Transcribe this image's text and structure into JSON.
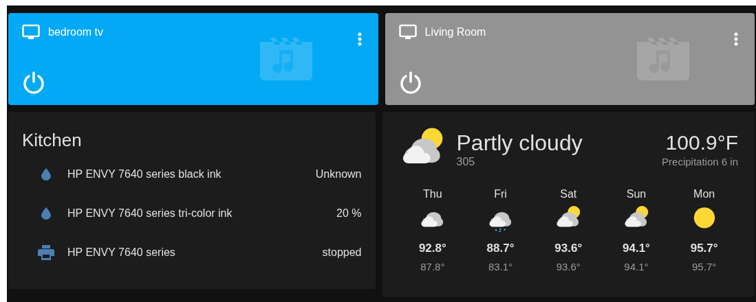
{
  "media_players": [
    {
      "name": "bedroom tv",
      "on": true
    },
    {
      "name": "Living Room",
      "on": false
    }
  ],
  "entities_card": {
    "title": "Kitchen",
    "rows": [
      {
        "kind": "ink",
        "name": "HP ENVY 7640 series black ink",
        "state": "Unknown"
      },
      {
        "kind": "ink",
        "name": "HP ENVY 7640 series tri-color ink",
        "state": "20 %"
      },
      {
        "kind": "printer",
        "name": "HP ENVY 7640 series",
        "state": "stopped"
      }
    ]
  },
  "weather": {
    "condition": "Partly cloudy",
    "kind": "partlycloudy",
    "subtitle": "305",
    "temperature": "100.9°F",
    "precipitation": "Precipitation 6 in",
    "forecast": [
      {
        "day": "Thu",
        "kind": "cloudy",
        "high": "92.8°",
        "low": "87.8°"
      },
      {
        "day": "Fri",
        "kind": "rainy",
        "high": "88.7°",
        "low": "83.1°"
      },
      {
        "day": "Sat",
        "kind": "partlycloudy",
        "high": "93.6°",
        "low": "93.6°"
      },
      {
        "day": "Sun",
        "kind": "partlycloudy",
        "high": "94.1°",
        "low": "94.1°"
      },
      {
        "day": "Mon",
        "kind": "sunny",
        "high": "95.7°",
        "low": "95.7°"
      }
    ]
  }
}
